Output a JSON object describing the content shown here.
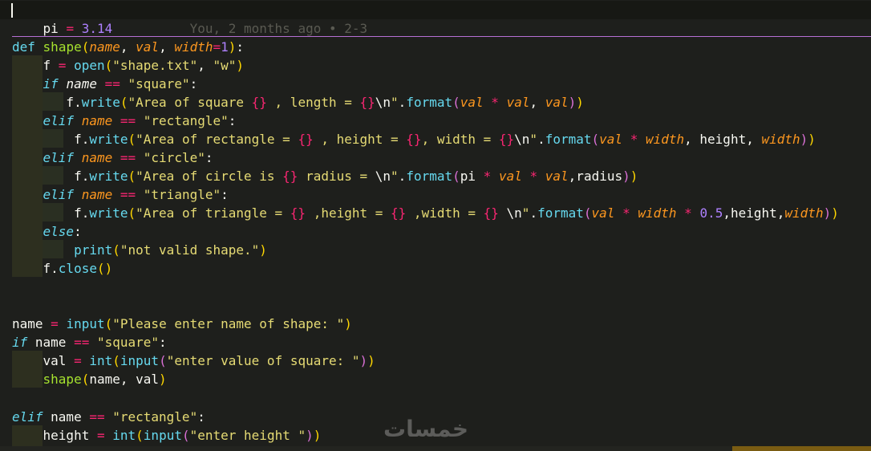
{
  "lines": [
    "pi = 3.14",
    "def shape(name, val, width=1):",
    "    f = open(\"shape.txt\", \"w\")",
    "    if name == \"square\":",
    "       f.write(\"Area of square {} , length = {}\\n\".format(val * val, val))",
    "    elif name == \"rectangle\":",
    "        f.write(\"Area of rectangle = {} , height = {}, width = {}\\n\".format(val * width, height, width))",
    "    elif name == \"circle\":",
    "        f.write(\"Area of circle is {} radius = \\n\".format(pi * val * val,radius))",
    "    elif name == \"triangle\":",
    "        f.write(\"Area of triangle = {} ,height = {} ,width = {} \\n\".format(val * width * 0.5,height,width))",
    "    else:",
    "        print(\"not valid shape.\")",
    "    f.close()",
    "name = input(\"Please enter name of shape: \")",
    "if name == \"square\":",
    "    val = int(input(\"enter value of square: \"))",
    "    shape(name, val)",
    "elif name == \"rectangle\":",
    "    height = int(input(\"enter height \"))"
  ],
  "blame": "You, 2 months ago • 2-3",
  "watermark": "خمسات"
}
